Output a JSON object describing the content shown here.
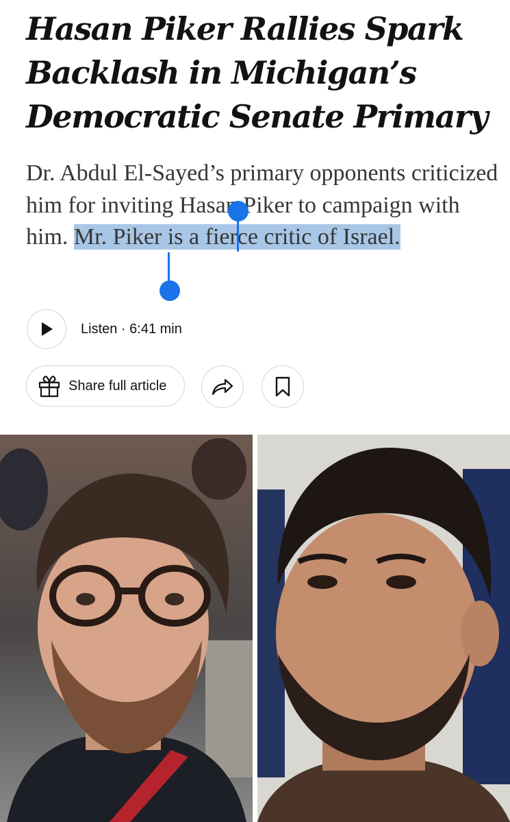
{
  "article": {
    "headline": "Hasan Piker Rallies Spark Backlash in Michigan’s Democratic Senate Primary",
    "summary_before_selection": "Dr. Abdul El-Sayed’s primary opponents criticized him for inviting Hasan Piker to campaign with him. ",
    "summary_selected": "Mr. Piker is a fierce critic of Israel.",
    "selection_color": "#a8c6e6",
    "handle_color": "#1a73e8"
  },
  "audio": {
    "play_icon": "play-icon",
    "listen_label": "Listen · 6:41 min"
  },
  "share": {
    "gift_icon": "gift-icon",
    "share_label": "Share full article",
    "forward_icon": "share-arrow-icon",
    "bookmark_icon": "bookmark-icon"
  },
  "photos": {
    "left_subject": "man-with-glasses-photo",
    "right_subject": "man-with-beard-photo"
  }
}
